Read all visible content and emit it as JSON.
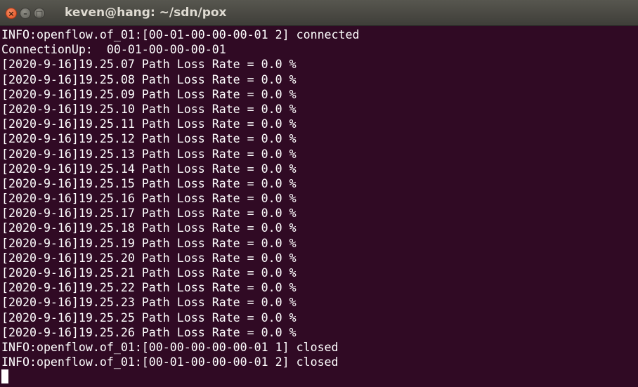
{
  "window": {
    "title": "keven@hang: ~/sdn/pox"
  },
  "controls": {
    "close_glyph": "×",
    "minimize_glyph": "–",
    "maximize_glyph": "□"
  },
  "colors": {
    "terminal_bg": "#300a24",
    "text": "#ffffff",
    "close_button": "#e1511f"
  },
  "terminal": {
    "lines": [
      "INFO:openflow.of_01:[00-01-00-00-00-01 2] connected",
      "ConnectionUp:  00-01-00-00-00-01",
      "[2020-9-16]19.25.07 Path Loss Rate = 0.0 %",
      "[2020-9-16]19.25.08 Path Loss Rate = 0.0 %",
      "[2020-9-16]19.25.09 Path Loss Rate = 0.0 %",
      "[2020-9-16]19.25.10 Path Loss Rate = 0.0 %",
      "[2020-9-16]19.25.11 Path Loss Rate = 0.0 %",
      "[2020-9-16]19.25.12 Path Loss Rate = 0.0 %",
      "[2020-9-16]19.25.13 Path Loss Rate = 0.0 %",
      "[2020-9-16]19.25.14 Path Loss Rate = 0.0 %",
      "[2020-9-16]19.25.15 Path Loss Rate = 0.0 %",
      "[2020-9-16]19.25.16 Path Loss Rate = 0.0 %",
      "[2020-9-16]19.25.17 Path Loss Rate = 0.0 %",
      "[2020-9-16]19.25.18 Path Loss Rate = 0.0 %",
      "[2020-9-16]19.25.19 Path Loss Rate = 0.0 %",
      "[2020-9-16]19.25.20 Path Loss Rate = 0.0 %",
      "[2020-9-16]19.25.21 Path Loss Rate = 0.0 %",
      "[2020-9-16]19.25.22 Path Loss Rate = 0.0 %",
      "[2020-9-16]19.25.23 Path Loss Rate = 0.0 %",
      "[2020-9-16]19.25.25 Path Loss Rate = 0.0 %",
      "[2020-9-16]19.25.26 Path Loss Rate = 0.0 %",
      "INFO:openflow.of_01:[00-00-00-00-00-01 1] closed",
      "INFO:openflow.of_01:[00-01-00-00-00-01 2] closed"
    ]
  }
}
